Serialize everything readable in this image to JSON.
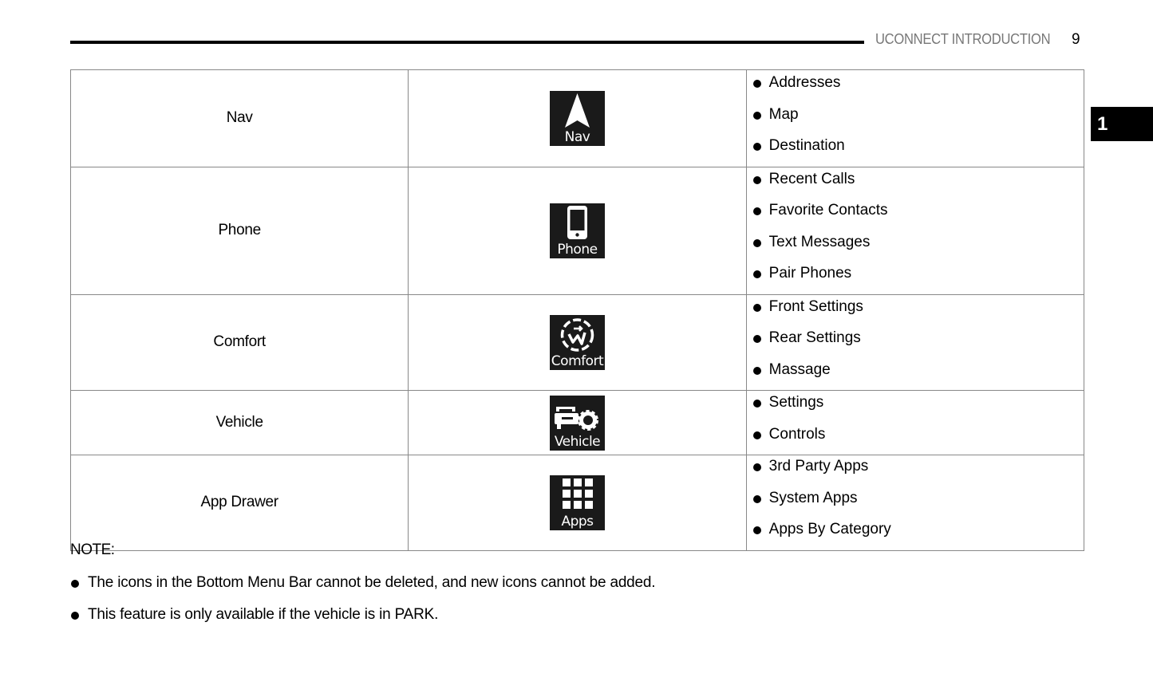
{
  "header": {
    "section_title": "UCONNECT INTRODUCTION",
    "page_number": "9",
    "chapter_tab": "1"
  },
  "table": {
    "rows": [
      {
        "name": "Nav",
        "icon": "nav-arrow-icon",
        "icon_label": "Nav",
        "features": [
          "Addresses",
          "Map",
          "Destination"
        ]
      },
      {
        "name": "Phone",
        "icon": "smartphone-icon",
        "icon_label": "Phone",
        "features": [
          "Recent Calls",
          "Favorite Contacts",
          "Text Messages",
          "Pair Phones"
        ]
      },
      {
        "name": "Comfort",
        "icon": "comfort-seat-icon",
        "icon_label": "Comfort",
        "features": [
          "Front Settings",
          "Rear Settings",
          "Massage"
        ]
      },
      {
        "name": "Vehicle",
        "icon": "vehicle-gear-icon",
        "icon_label": "Vehicle",
        "features": [
          "Settings",
          "Controls"
        ]
      },
      {
        "name": "App Drawer",
        "icon": "app-grid-icon",
        "icon_label": "Apps",
        "features": [
          "3rd Party Apps",
          "System Apps",
          "Apps By Category"
        ]
      }
    ]
  },
  "note": {
    "title": "NOTE:",
    "items": [
      "The icons in the Bottom Menu Bar cannot be deleted, and new icons cannot be added.",
      "This feature is only available if the vehicle is in PARK."
    ]
  }
}
